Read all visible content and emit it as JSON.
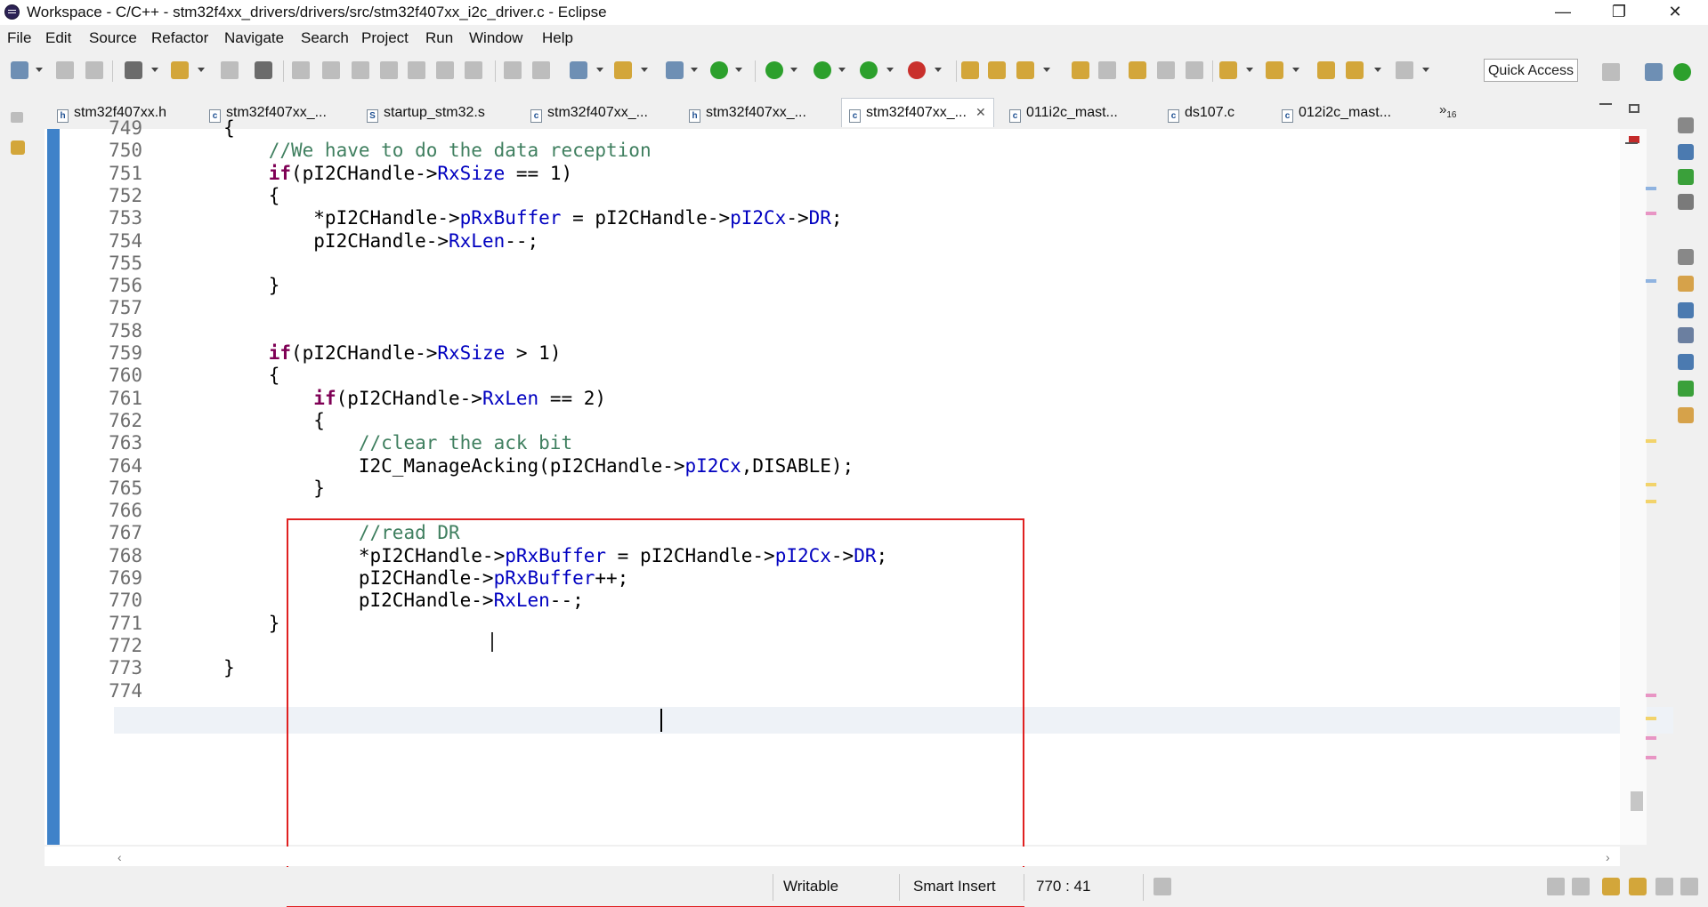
{
  "window": {
    "title": "Workspace - C/C++ - stm32f4xx_drivers/drivers/src/stm32f407xx_i2c_driver.c - Eclipse",
    "minimize": "—",
    "maximize": "❐",
    "close": "✕"
  },
  "menu": [
    "File",
    "Edit",
    "Source",
    "Refactor",
    "Navigate",
    "Search",
    "Project",
    "Run",
    "Window",
    "Help"
  ],
  "toolbar": {
    "quick_access": "Quick Access"
  },
  "tabs": [
    {
      "icon": "h",
      "label": "stm32f407xx.h"
    },
    {
      "icon": "c",
      "label": "stm32f407xx_..."
    },
    {
      "icon": "S",
      "label": "startup_stm32.s"
    },
    {
      "icon": "c",
      "label": "stm32f407xx_..."
    },
    {
      "icon": "h",
      "label": "stm32f407xx_..."
    },
    {
      "icon": "c",
      "label": "stm32f407xx_...",
      "active": true
    },
    {
      "icon": "c",
      "label": "011i2c_mast..."
    },
    {
      "icon": "c",
      "label": "ds107.c"
    },
    {
      "icon": "c",
      "label": "012i2c_mast..."
    }
  ],
  "tab_overflow": {
    "glyph": "»",
    "count": "16"
  },
  "editor": {
    "lines": [
      {
        "n": "749",
        "code": "        {"
      },
      {
        "n": "750",
        "code": "            //We have to do the data reception"
      },
      {
        "n": "751",
        "code": "            if(pI2CHandle->RxSize == 1)"
      },
      {
        "n": "752",
        "code": "            {"
      },
      {
        "n": "753",
        "code": "                *pI2CHandle->pRxBuffer = pI2CHandle->pI2Cx->DR;"
      },
      {
        "n": "754",
        "code": "                pI2CHandle->RxLen--;"
      },
      {
        "n": "755",
        "code": ""
      },
      {
        "n": "756",
        "code": "            }"
      },
      {
        "n": "757",
        "code": ""
      },
      {
        "n": "758",
        "code": ""
      },
      {
        "n": "759",
        "code": "            if(pI2CHandle->RxSize > 1)"
      },
      {
        "n": "760",
        "code": "            {"
      },
      {
        "n": "761",
        "code": "                if(pI2CHandle->RxLen == 2)"
      },
      {
        "n": "762",
        "code": "                {"
      },
      {
        "n": "763",
        "code": "                    //clear the ack bit"
      },
      {
        "n": "764",
        "code": "                    I2C_ManageAcking(pI2CHandle->pI2Cx,DISABLE);"
      },
      {
        "n": "765",
        "code": "                }"
      },
      {
        "n": "766",
        "code": ""
      },
      {
        "n": "767",
        "code": "                    //read DR"
      },
      {
        "n": "768",
        "code": "                    *pI2CHandle->pRxBuffer = pI2CHandle->pI2Cx->DR;"
      },
      {
        "n": "769",
        "code": "                    pI2CHandle->pRxBuffer++;"
      },
      {
        "n": "770",
        "code": "                    pI2CHandle->RxLen--;"
      },
      {
        "n": "771",
        "code": "            }"
      },
      {
        "n": "772",
        "code": ""
      },
      {
        "n": "773",
        "code": "        }"
      },
      {
        "n": "774",
        "code": ""
      }
    ]
  },
  "status": {
    "mode": "Writable",
    "insert": "Smart Insert",
    "position": "770 : 41"
  }
}
